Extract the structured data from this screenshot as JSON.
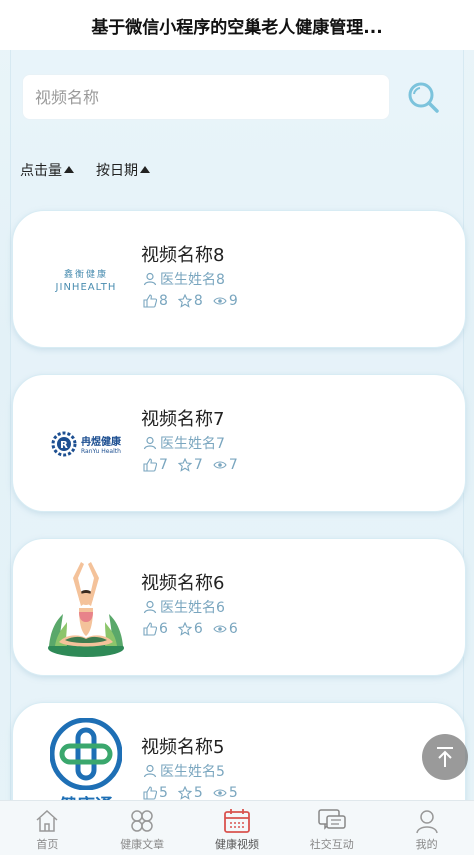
{
  "header": {
    "title": "基于微信小程序的空巢老人健康管理..."
  },
  "search": {
    "placeholder": "视频名称"
  },
  "sort": [
    {
      "label": "点击量"
    },
    {
      "label": "按日期"
    }
  ],
  "videos": [
    {
      "name": "视频名称8",
      "doctor": "医生姓名8",
      "likes": "8",
      "favorites": "8",
      "views": "9",
      "logo_text": "鑫衡健康",
      "logo_sub": "JINHEALTH"
    },
    {
      "name": "视频名称7",
      "doctor": "医生姓名7",
      "likes": "7",
      "favorites": "7",
      "views": "7",
      "logo_text": "冉煜健康",
      "logo_sub": "RanYu Health"
    },
    {
      "name": "视频名称6",
      "doctor": "医生姓名6",
      "likes": "6",
      "favorites": "6",
      "views": "6"
    },
    {
      "name": "视频名称5",
      "doctor": "医生姓名5",
      "likes": "5",
      "favorites": "5",
      "views": "5",
      "logo_text": "健康通"
    }
  ],
  "tabs": [
    {
      "label": "首页",
      "icon": "home-icon"
    },
    {
      "label": "健康文章",
      "icon": "clover-icon"
    },
    {
      "label": "健康视频",
      "icon": "calendar-icon"
    },
    {
      "label": "社交互动",
      "icon": "chat-icon"
    },
    {
      "label": "我的",
      "icon": "user-icon"
    }
  ],
  "colors": {
    "accent": "#7aa6bf",
    "active_tab": "#d9534f",
    "search_icon": "#7cc3dc"
  }
}
